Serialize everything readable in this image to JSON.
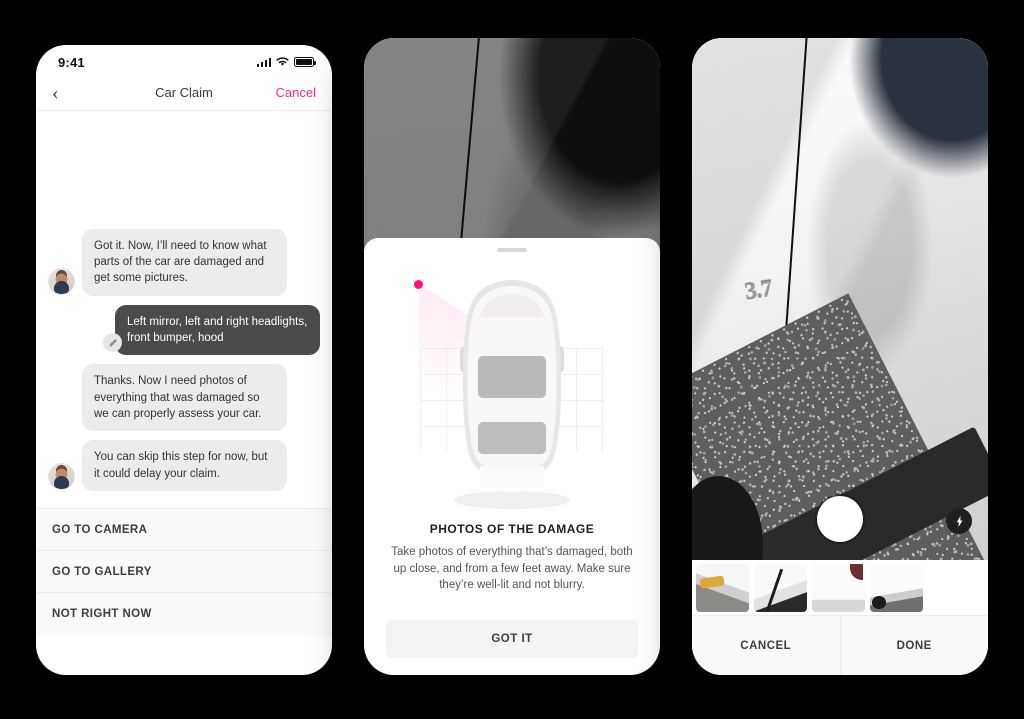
{
  "screen_claim": {
    "status_bar": {
      "time": "9:41",
      "signal_icon": "signal-bars-icon",
      "wifi_icon": "wifi-icon",
      "battery_icon": "battery-icon"
    },
    "nav": {
      "back_icon": "chevron-left-icon",
      "title": "Car Claim",
      "cancel_label": "Cancel",
      "cancel_color": "#FF2D87"
    },
    "messages": [
      {
        "from": "agent",
        "text": "Got it. Now, I’ll need to know what parts of the car are damaged and get some pictures.",
        "avatar": true
      },
      {
        "from": "user",
        "text": "Left mirror, left and right headlights, front bumper, hood",
        "edit_icon": "pencil-icon"
      },
      {
        "from": "agent",
        "text": "Thanks. Now I need photos of everything that was damaged so we can properly assess your car.",
        "avatar": false
      },
      {
        "from": "agent",
        "text": "You can skip this step for now, but it could delay your claim.",
        "avatar": true
      }
    ],
    "actions": [
      {
        "label": "GO TO CAMERA"
      },
      {
        "label": "GO TO GALLERY"
      },
      {
        "label": "NOT RIGHT NOW"
      }
    ]
  },
  "screen_instructions": {
    "grabber": "sheet-grabber",
    "illustration": {
      "name": "car-top-view-illustration",
      "marker_color": "#FF1478",
      "body_color": "#f5f5f5"
    },
    "title": "PHOTOS OF THE DAMAGE",
    "body": "Take photos of everything that’s damaged, both up close, and from a few feet away. Make sure they’re well-lit and not blurry.",
    "primary_button": "GOT IT"
  },
  "screen_camera": {
    "viewfinder": {
      "name": "camera-viewfinder",
      "subject_badge": "3.7"
    },
    "shutter": "shutter-button",
    "flash": {
      "icon": "flash-bolt-icon",
      "state": "on"
    },
    "thumbnails": [
      {
        "name": "thumbnail-front-bumper"
      },
      {
        "name": "thumbnail-hood-crease"
      },
      {
        "name": "thumbnail-fender-scrape"
      },
      {
        "name": "thumbnail-side-panel"
      }
    ],
    "footer": {
      "cancel_label": "CANCEL",
      "done_label": "DONE"
    }
  }
}
